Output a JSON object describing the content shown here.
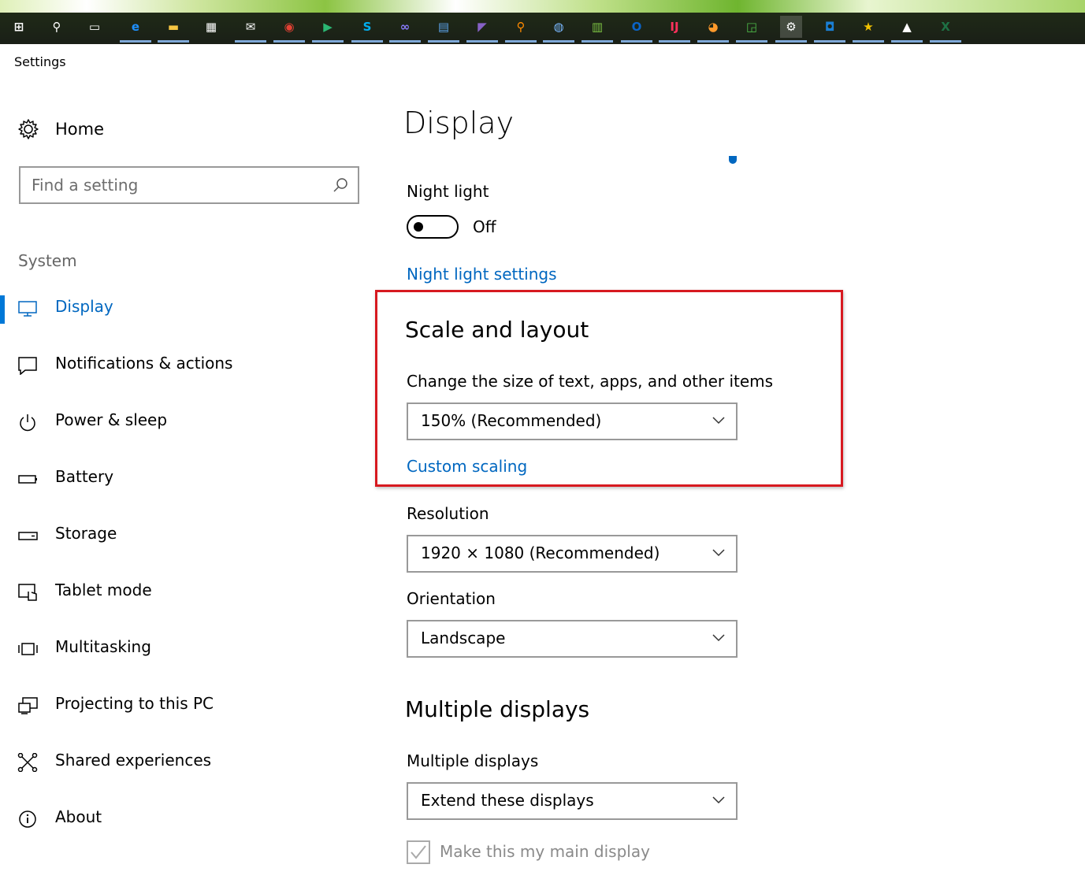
{
  "taskbar": {
    "icons": [
      {
        "name": "start-icon",
        "glyph": "⊞",
        "color": "#ffffff"
      },
      {
        "name": "search-icon",
        "glyph": "⚲",
        "color": "#ffffff"
      },
      {
        "name": "task-view-icon",
        "glyph": "▭",
        "color": "#ffffff"
      },
      {
        "name": "edge-icon",
        "glyph": "e",
        "color": "#1e90ff"
      },
      {
        "name": "file-explorer-icon",
        "glyph": "▬",
        "color": "#f5c542"
      },
      {
        "name": "store-icon",
        "glyph": "▦",
        "color": "#ffffff"
      },
      {
        "name": "mail-icon",
        "glyph": "✉",
        "color": "#ffffff"
      },
      {
        "name": "chrome-icon",
        "glyph": "◉",
        "color": "#e44134"
      },
      {
        "name": "media-player-icon",
        "glyph": "▶",
        "color": "#2bb673"
      },
      {
        "name": "skype-icon",
        "glyph": "S",
        "color": "#00aff0"
      },
      {
        "name": "infinity-app-icon",
        "glyph": "∞",
        "color": "#8a7cff"
      },
      {
        "name": "window-app-icon",
        "glyph": "▤",
        "color": "#5aa0e6"
      },
      {
        "name": "visual-studio-icon",
        "glyph": "◤",
        "color": "#8661c5"
      },
      {
        "name": "magnifier-app-icon",
        "glyph": "⚲",
        "color": "#ff8a00"
      },
      {
        "name": "globe-app-icon",
        "glyph": "◍",
        "color": "#7ab8ff"
      },
      {
        "name": "chart-app-icon",
        "glyph": "▥",
        "color": "#7cc243"
      },
      {
        "name": "outlook-icon",
        "glyph": "O",
        "color": "#0a64c8"
      },
      {
        "name": "intellij-icon",
        "glyph": "IJ",
        "color": "#fe315d"
      },
      {
        "name": "basketball-app-icon",
        "glyph": "◕",
        "color": "#ff9a2b"
      },
      {
        "name": "green-app-icon",
        "glyph": "◲",
        "color": "#4db848"
      },
      {
        "name": "settings-gear-icon",
        "glyph": "⚙",
        "color": "#ffffff"
      },
      {
        "name": "blue-app-icon",
        "glyph": "◘",
        "color": "#1a7fd4"
      },
      {
        "name": "star-app-icon",
        "glyph": "★",
        "color": "#f2c200"
      },
      {
        "name": "photos-icon",
        "glyph": "▲",
        "color": "#ffffff"
      },
      {
        "name": "excel-icon",
        "glyph": "X",
        "color": "#1e7145"
      }
    ]
  },
  "window": {
    "title": "Settings"
  },
  "sidebar": {
    "home_label": "Home",
    "search_placeholder": "Find a setting",
    "section_label": "System",
    "items": [
      {
        "label": "Display",
        "icon": "monitor-icon",
        "active": true
      },
      {
        "label": "Notifications & actions",
        "icon": "notifications-icon"
      },
      {
        "label": "Power & sleep",
        "icon": "power-icon"
      },
      {
        "label": "Battery",
        "icon": "battery-icon"
      },
      {
        "label": "Storage",
        "icon": "storage-icon"
      },
      {
        "label": "Tablet mode",
        "icon": "tablet-mode-icon"
      },
      {
        "label": "Multitasking",
        "icon": "multitasking-icon"
      },
      {
        "label": "Projecting to this PC",
        "icon": "projecting-icon"
      },
      {
        "label": "Shared experiences",
        "icon": "shared-experiences-icon"
      },
      {
        "label": "About",
        "icon": "info-icon"
      }
    ]
  },
  "main": {
    "title": "Display",
    "night_light": {
      "label": "Night light",
      "state": "Off",
      "settings_link": "Night light settings"
    },
    "scale_layout": {
      "heading": "Scale and layout",
      "size_label": "Change the size of text, apps, and other items",
      "size_value": "150% (Recommended)",
      "custom_link": "Custom scaling"
    },
    "resolution": {
      "label": "Resolution",
      "value": "1920 × 1080 (Recommended)"
    },
    "orientation": {
      "label": "Orientation",
      "value": "Landscape"
    },
    "multiple_displays": {
      "heading": "Multiple displays",
      "label": "Multiple displays",
      "value": "Extend these displays",
      "main_display_label": "Make this my main display"
    }
  },
  "colors": {
    "accent": "#0078d7",
    "link": "#0067c0",
    "highlight_border": "#d71920"
  }
}
